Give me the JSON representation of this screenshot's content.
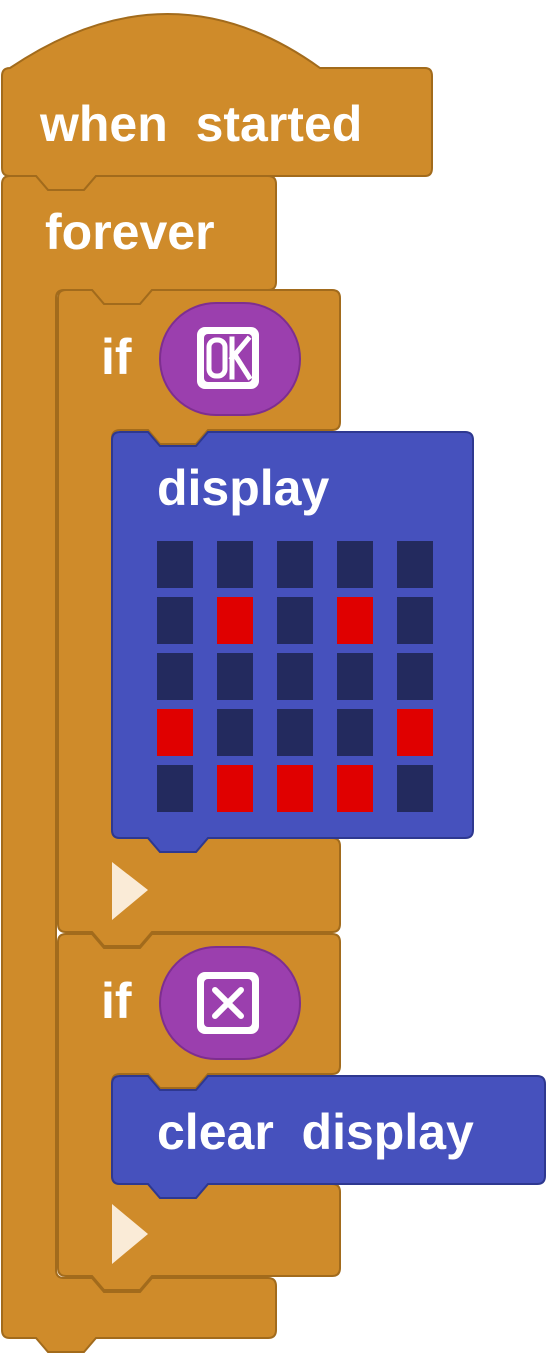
{
  "program": {
    "hat": {
      "label": "when  started"
    },
    "forever": {
      "label": "forever"
    },
    "if_ok": {
      "keyword": "if",
      "condition_icon": "ok-button-icon",
      "display_block": {
        "label": "display",
        "led_grid": [
          [
            0,
            0,
            0,
            0,
            0
          ],
          [
            0,
            1,
            0,
            1,
            0
          ],
          [
            0,
            0,
            0,
            0,
            0
          ],
          [
            1,
            0,
            0,
            0,
            1
          ],
          [
            0,
            1,
            1,
            1,
            0
          ]
        ]
      }
    },
    "if_x": {
      "keyword": "if",
      "condition_icon": "x-button-icon",
      "clear_block": {
        "label": "clear  display"
      }
    },
    "else_arrow_icon": "expand-triangle-icon"
  },
  "colors": {
    "control": "#CF8B2A",
    "control_stroke": "#A26B1C",
    "display": "#4651BD",
    "display_stroke": "#2E3890",
    "sensor": "#9B3FAE",
    "led_on": "#E00000",
    "led_off": "#232A5E",
    "arrow": "#FAEBD7"
  }
}
